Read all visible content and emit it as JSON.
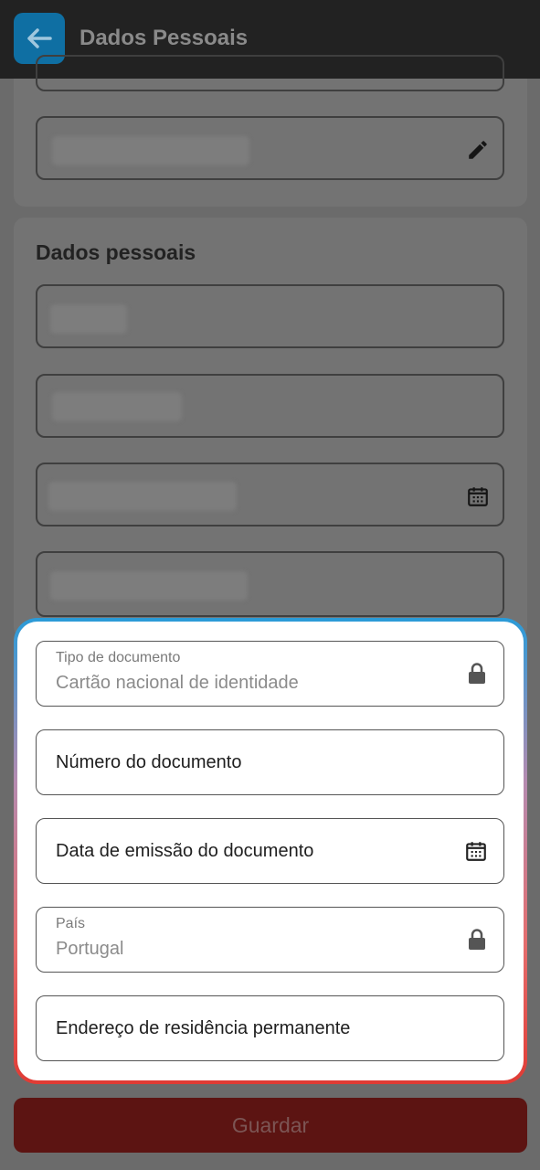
{
  "appbar": {
    "title": "Dados Pessoais",
    "back_icon": "arrow-left-icon"
  },
  "section": {
    "title": "Dados pessoais"
  },
  "form": {
    "document_type": {
      "label": "Tipo de documento",
      "value": "Cartão nacional de identidade",
      "icon": "lock-icon"
    },
    "document_number": {
      "placeholder": "Número do documento"
    },
    "issue_date": {
      "placeholder": "Data de emissão do documento",
      "icon": "calendar-icon"
    },
    "country": {
      "label": "País",
      "value": "Portugal",
      "icon": "lock-icon"
    },
    "address": {
      "placeholder": "Endereço de residência permanente"
    }
  },
  "save_button": {
    "label": "Guardar"
  },
  "colors": {
    "appbar": "#222222",
    "accent_blue": "#0f6fa3",
    "save_red": "#5c1412"
  }
}
